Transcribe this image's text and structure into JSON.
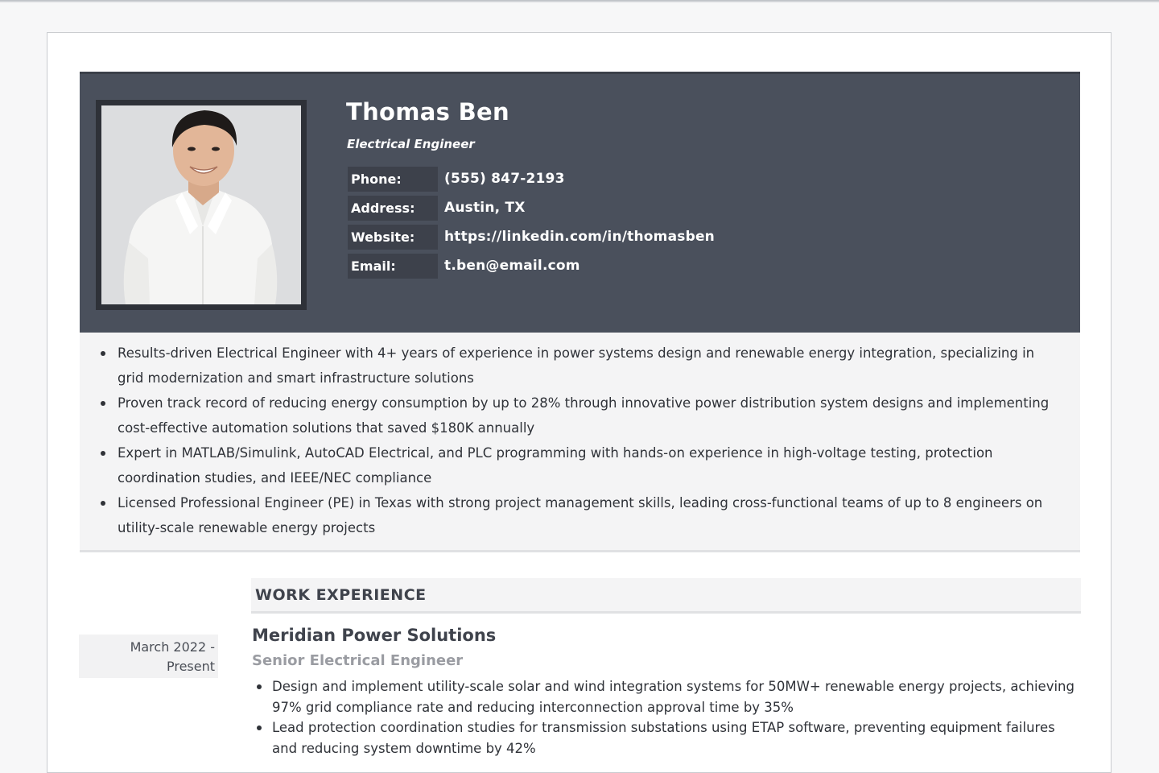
{
  "profile": {
    "name": "Thomas Ben",
    "title": "Electrical Engineer",
    "photo_icon": "person-portrait-icon"
  },
  "contacts": [
    {
      "label": "Phone:",
      "value": "(555) 847-2193"
    },
    {
      "label": "Address:",
      "value": "Austin, TX"
    },
    {
      "label": "Website:",
      "value": "https://linkedin.com/in/thomasben"
    },
    {
      "label": "Email:",
      "value": "t.ben@email.com"
    }
  ],
  "summary": [
    "Results-driven Electrical Engineer with 4+ years of experience in power systems design and renewable energy integration, specializing in grid modernization and smart infrastructure solutions",
    "Proven track record of reducing energy consumption by up to 28% through innovative power distribution system designs and implementing cost-effective automation solutions that saved $180K annually",
    "Expert in MATLAB/Simulink, AutoCAD Electrical, and PLC programming with hands-on experience in high-voltage testing, protection coordination studies, and IEEE/NEC compliance",
    "Licensed Professional Engineer (PE) in Texas with strong project management skills, leading cross-functional teams of up to 8 engineers on utility-scale renewable energy projects"
  ],
  "work": {
    "heading": "WORK EXPERIENCE",
    "jobs": [
      {
        "date_start": "March 2022 -",
        "date_end": "Present",
        "company": "Meridian Power Solutions",
        "role": "Senior Electrical Engineer",
        "duties": [
          "Design and implement utility-scale solar and wind integration systems for 50MW+ renewable energy projects, achieving 97% grid compliance rate and reducing interconnection approval time by 35%",
          "Lead protection coordination studies for transmission substations using ETAP software, preventing equipment failures and reducing system downtime by 42%"
        ]
      }
    ]
  },
  "colors": {
    "header_bg": "#4a505c",
    "label_bg": "#3d414b",
    "summary_bg": "#f4f4f5",
    "role_text": "#9a9ca2"
  }
}
